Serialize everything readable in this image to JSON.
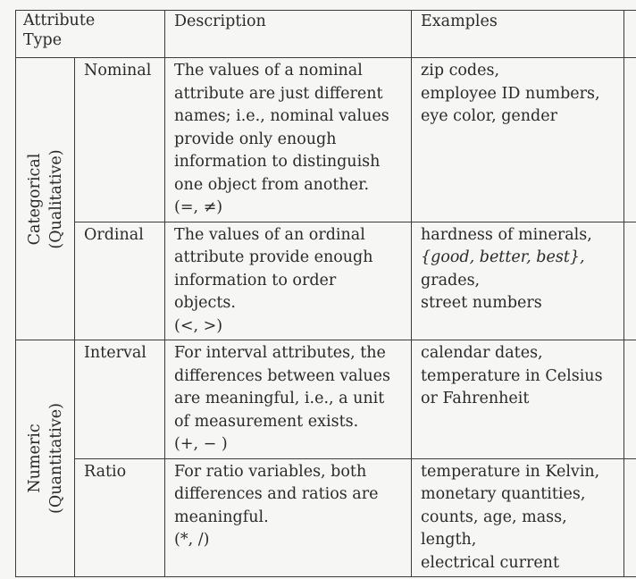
{
  "table": {
    "header": {
      "attribute_type": [
        "Attribute",
        "Type"
      ],
      "description": "Description",
      "examples": "Examples"
    },
    "groups": [
      {
        "label_lines": [
          "Categorical",
          "(Qualitative)"
        ],
        "rows": [
          {
            "subtype": "Nominal",
            "description_lines": [
              "The values of a nominal",
              "attribute are just different",
              "names; i.e., nominal values",
              "provide only enough",
              "information to distinguish",
              "one object from another.",
              "(=, ≠)"
            ],
            "examples_lines": [
              "zip codes,",
              "employee ID numbers,",
              "eye color, gender"
            ]
          },
          {
            "subtype": "Ordinal",
            "description_lines": [
              "The values of an ordinal",
              "attribute provide enough",
              "information to order",
              "objects.",
              "(<, >)"
            ],
            "examples_lines": [
              "hardness of minerals,",
              "{good, better, best},",
              "grades,",
              "street numbers"
            ]
          }
        ]
      },
      {
        "label_lines": [
          "Numeric",
          "(Quantitative)"
        ],
        "rows": [
          {
            "subtype": "Interval",
            "description_lines": [
              "For interval attributes, the",
              "differences between values",
              "are meaningful, i.e., a unit",
              "of measurement exists.",
              "(+, − )"
            ],
            "examples_lines": [
              "calendar dates,",
              "temperature in Celsius",
              "or Fahrenheit"
            ]
          },
          {
            "subtype": "Ratio",
            "description_lines": [
              "For ratio variables, both",
              "differences and ratios are",
              "meaningful.",
              "(*, /)"
            ],
            "examples_lines": [
              "temperature in Kelvin,",
              "monetary quantities,",
              "counts, age, mass,",
              "length,",
              "electrical current"
            ]
          }
        ]
      }
    ]
  }
}
